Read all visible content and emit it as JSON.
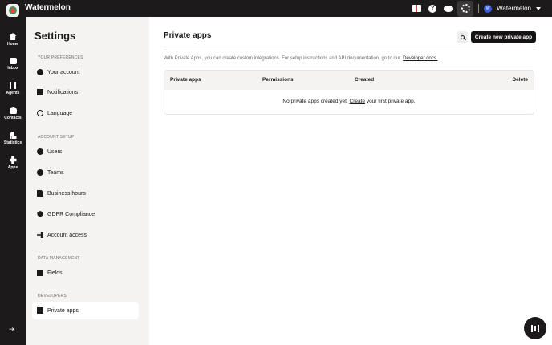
{
  "app": {
    "brand": "Watermelon"
  },
  "topbar": {
    "account_name": "Watermelon",
    "avatar_initials": "W"
  },
  "leftnav": {
    "items": [
      {
        "label": "Home",
        "icon": "home-icon"
      },
      {
        "label": "Inbox",
        "icon": "inbox-icon"
      },
      {
        "label": "Agents",
        "icon": "agents-icon"
      },
      {
        "label": "Contacts",
        "icon": "contacts-icon"
      },
      {
        "label": "Statistics",
        "icon": "statistics-icon"
      },
      {
        "label": "Apps",
        "icon": "apps-icon"
      }
    ]
  },
  "settings": {
    "title": "Settings",
    "sections": [
      {
        "heading": "YOUR PREFERENCES",
        "items": [
          "Your account",
          "Notifications",
          "Language"
        ]
      },
      {
        "heading": "ACCOUNT SETUP",
        "items": [
          "Users",
          "Teams",
          "Business hours",
          "GDPR Compliance",
          "Account access"
        ]
      },
      {
        "heading": "DATA MANAGEMENT",
        "items": [
          "Fields"
        ]
      },
      {
        "heading": "DEVELOPERS",
        "items": [
          "Private apps"
        ]
      }
    ],
    "active_item": "Private apps"
  },
  "main": {
    "title": "Private apps",
    "create_button": "Create new private app",
    "description": "With Private Apps, you can create custom integrations. For setup instructions and API documentation, go to our",
    "docs_link": "Developer docs.",
    "table": {
      "columns": [
        "Private apps",
        "Permissions",
        "Created",
        "Delete"
      ],
      "empty_prefix": "No private apps created yet.",
      "empty_link": "Create",
      "empty_suffix": "your first private app."
    }
  },
  "colors": {
    "dark": "#1c1a1a",
    "sidebar_bg": "#f4f3f2",
    "accent_red": "#e04b3f"
  }
}
